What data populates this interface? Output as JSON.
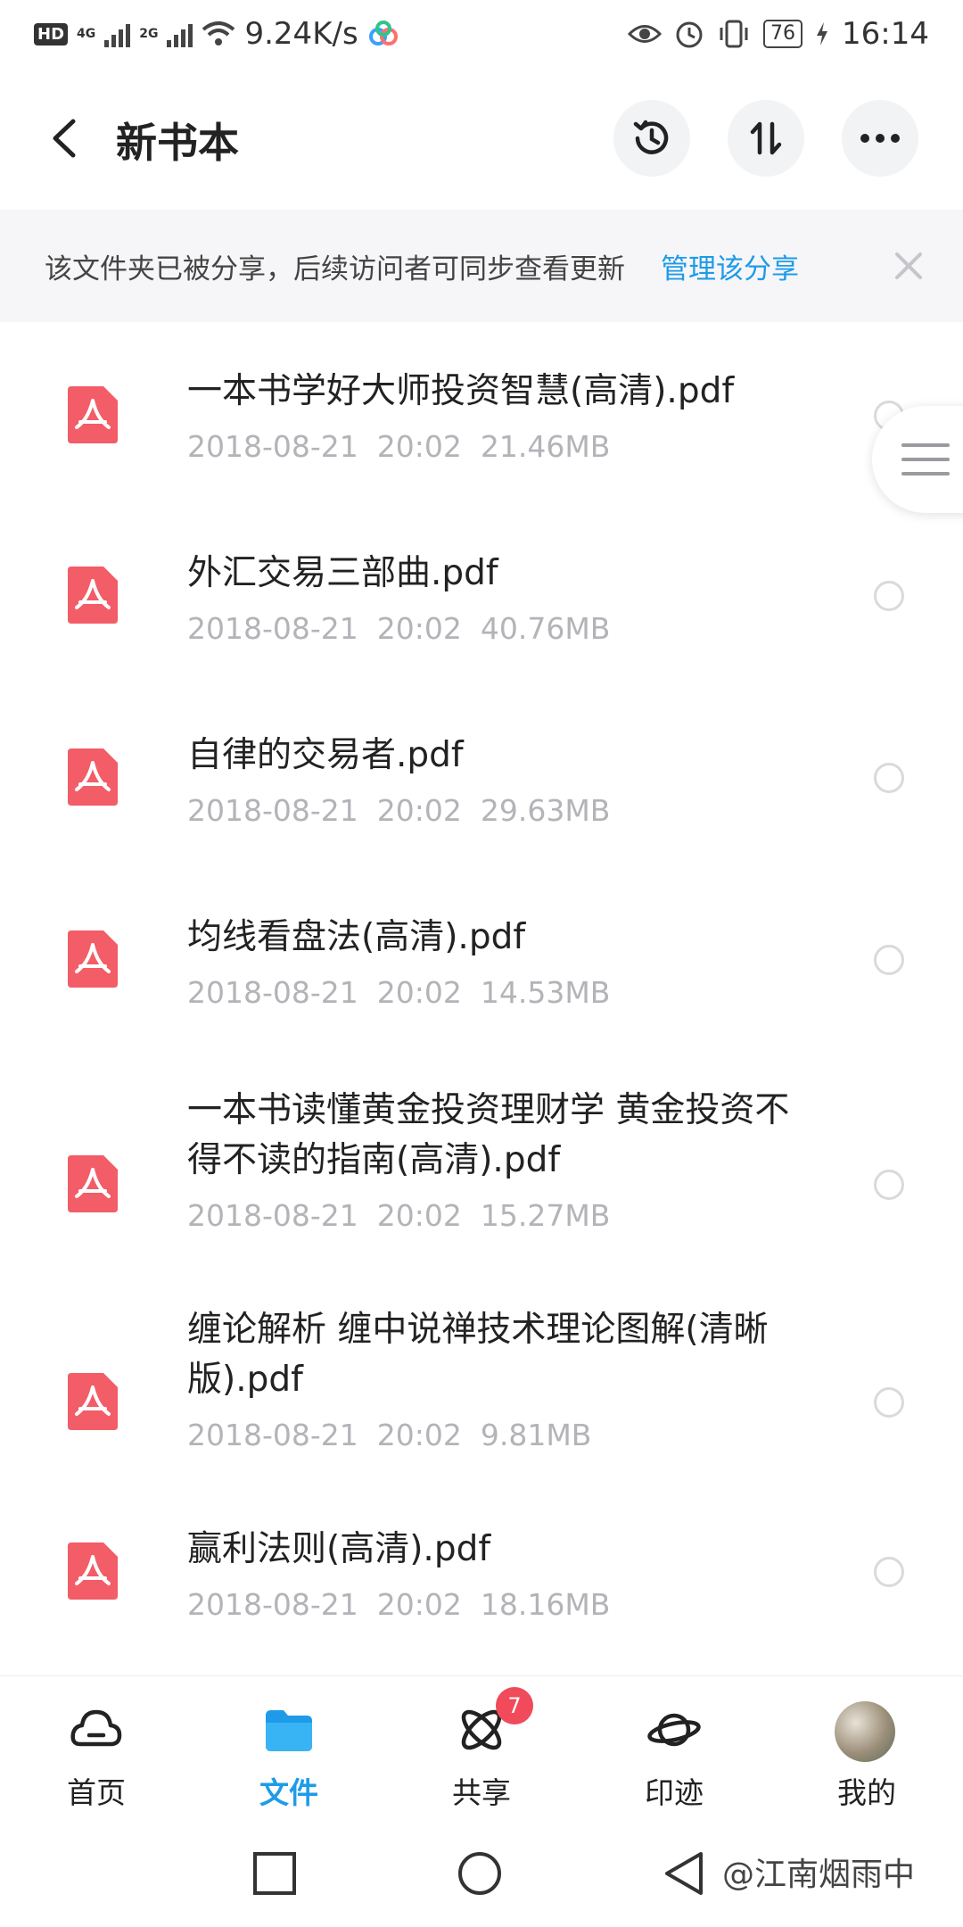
{
  "status_bar": {
    "hd": "HD",
    "net1": "4G",
    "net2": "2G",
    "speed": "9.24K/s",
    "battery": "76",
    "time": "16:14"
  },
  "header": {
    "title": "新书本",
    "buttons": [
      "history-icon",
      "sort-icon",
      "more-icon"
    ]
  },
  "banner": {
    "text": "该文件夹已被分享，后续访问者可同步查看更新",
    "link": "管理该分享"
  },
  "files": [
    {
      "name": "一本书学好大师投资智慧(高清).pdf",
      "date": "2018-08-21",
      "time": "20:02",
      "size": "21.46MB"
    },
    {
      "name": "外汇交易三部曲.pdf",
      "date": "2018-08-21",
      "time": "20:02",
      "size": "40.76MB"
    },
    {
      "name": "自律的交易者.pdf",
      "date": "2018-08-21",
      "time": "20:02",
      "size": "29.63MB"
    },
    {
      "name": "均线看盘法(高清).pdf",
      "date": "2018-08-21",
      "time": "20:02",
      "size": "14.53MB"
    },
    {
      "name": "一本书读懂黄金投资理财学  黄金投资不得不读的指南(高清).pdf",
      "date": "2018-08-21",
      "time": "20:02",
      "size": "15.27MB"
    },
    {
      "name": "缠论解析 缠中说禅技术理论图解(清晰版).pdf",
      "date": "2018-08-21",
      "time": "20:02",
      "size": "9.81MB"
    },
    {
      "name": "赢利法则(高清).pdf",
      "date": "2018-08-21",
      "time": "20:02",
      "size": "18.16MB"
    }
  ],
  "tabs": [
    {
      "label": "首页",
      "icon": "cloud-home-icon"
    },
    {
      "label": "文件",
      "icon": "folder-icon",
      "active": true
    },
    {
      "label": "共享",
      "icon": "atom-share-icon",
      "badge": "7"
    },
    {
      "label": "印迹",
      "icon": "planet-icon"
    },
    {
      "label": "我的",
      "icon": "avatar"
    }
  ],
  "watermark": "@江南烟雨中",
  "colors": {
    "accent": "#1e9be8",
    "pdf": "#f25d67",
    "badge": "#f04a5b"
  }
}
